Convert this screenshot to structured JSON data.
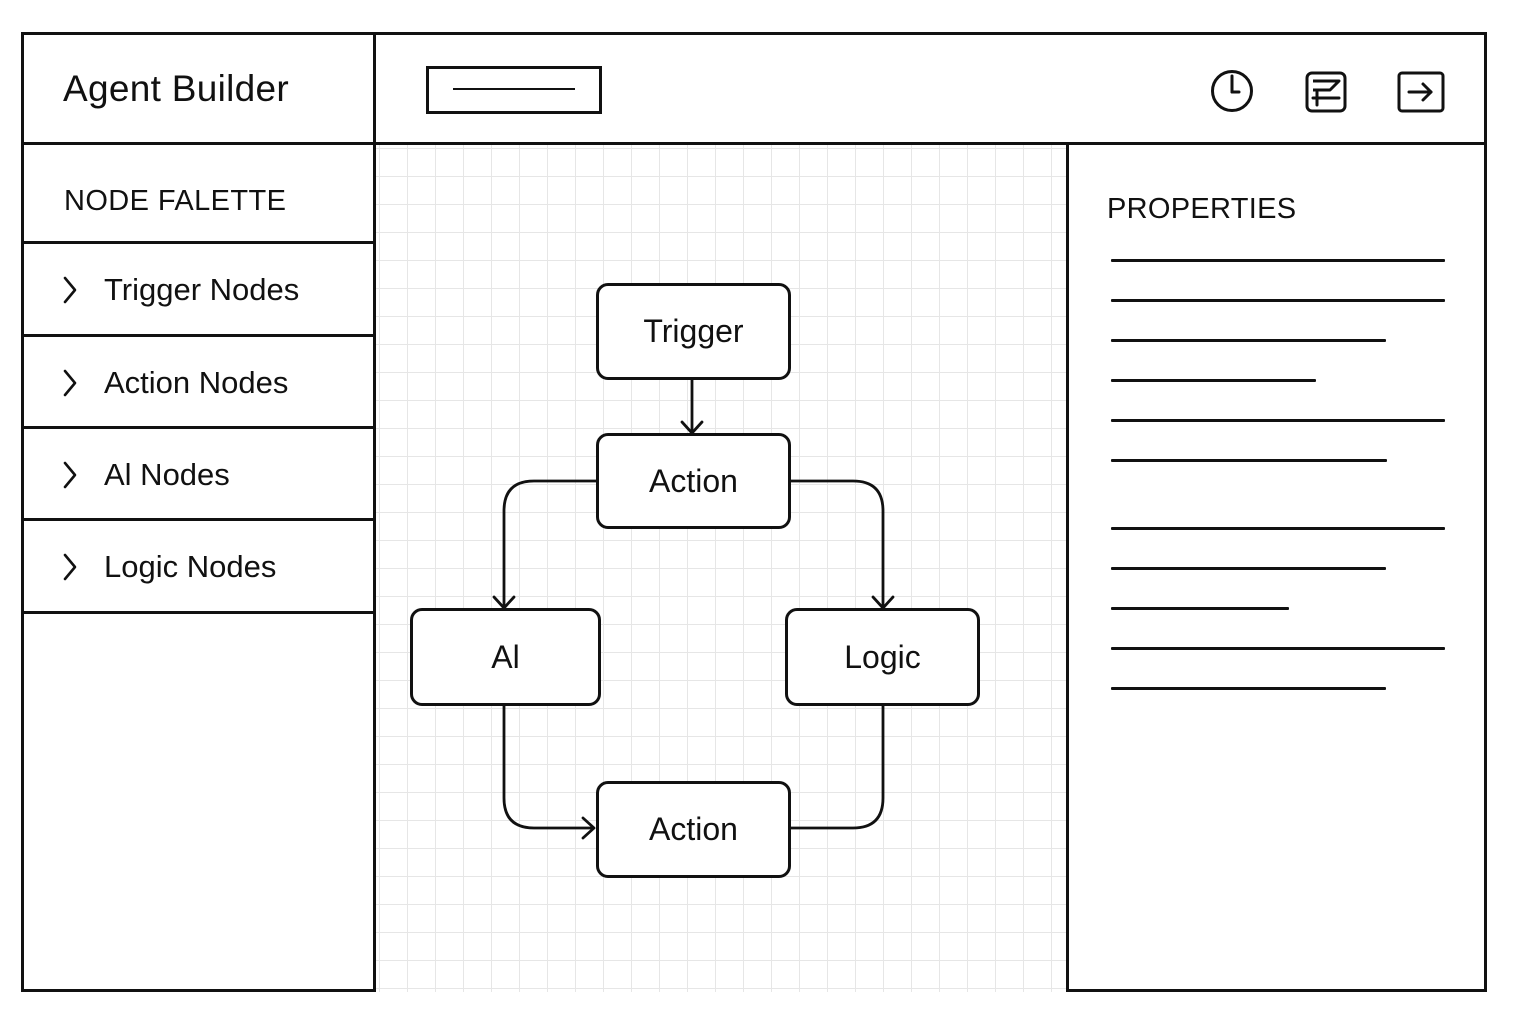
{
  "app": {
    "title": "Agent Builder"
  },
  "toolbar": {
    "search": {
      "value": "",
      "placeholder": ""
    },
    "icons": [
      "clock-icon",
      "save-icon",
      "export-icon"
    ]
  },
  "sidebar": {
    "title": "NODE FALETTE",
    "items": [
      {
        "label": "Trigger Nodes",
        "icon": "chevron-right-icon"
      },
      {
        "label": "Action Nodes",
        "icon": "chevron-right-icon"
      },
      {
        "label": "Al Nodes",
        "icon": "chevron-right-icon"
      },
      {
        "label": "Logic Nodes",
        "icon": "chevron-right-icon"
      }
    ]
  },
  "canvas": {
    "nodes": [
      {
        "id": "trigger",
        "label": "Trigger"
      },
      {
        "id": "action-1",
        "label": "Action"
      },
      {
        "id": "ai",
        "label": "Al"
      },
      {
        "id": "logic",
        "label": "Logic"
      },
      {
        "id": "action-2",
        "label": "Action"
      }
    ],
    "edges": [
      {
        "from": "trigger",
        "to": "action-1",
        "arrow": true
      },
      {
        "from": "action-1",
        "to": "ai",
        "arrow": true
      },
      {
        "from": "action-1",
        "to": "logic",
        "arrow": true
      },
      {
        "from": "ai",
        "to": "action-2",
        "arrow": true
      },
      {
        "from": "logic",
        "to": "action-2",
        "arrow": false
      }
    ]
  },
  "properties": {
    "title": "PROPERTIES",
    "placeholder_line_count": 11
  },
  "colors": {
    "stroke": "#111111",
    "background": "#ffffff",
    "grid": "#e6e6e6"
  }
}
